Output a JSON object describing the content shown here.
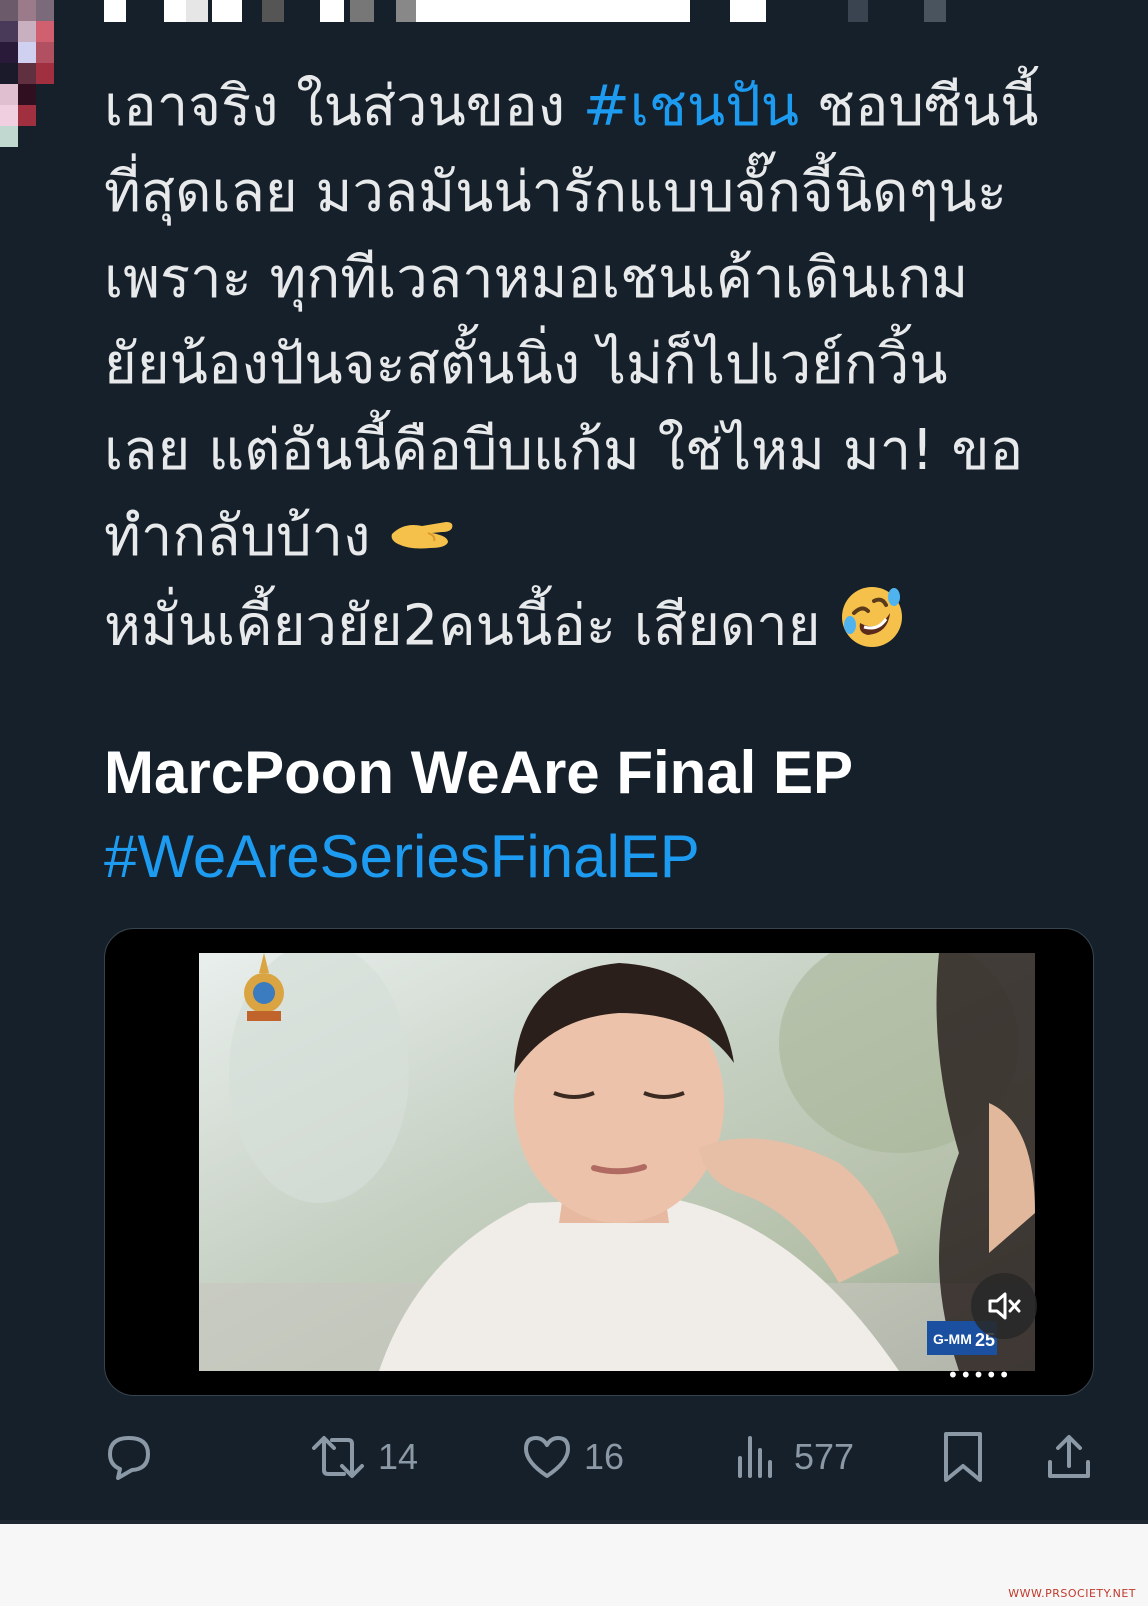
{
  "tweet": {
    "lines": [
      {
        "pre": "เอาจริง ในส่วนของ ",
        "hashtag": "#เชนปัน",
        "post": " ชอบซีนนี้"
      },
      {
        "pre": "ที่สุดเลย มวลมันน่ารักแบบจั๊กจี้นิดๆนะ",
        "hashtag": "",
        "post": ""
      },
      {
        "pre": "เพราะ ทุกทีเวลาหมอเชนเค้าเดินเกม",
        "hashtag": "",
        "post": ""
      },
      {
        "pre": "ยัยน้องปันจะสตั้นนิ่ง ไม่ก็ไปเวย์กวิ้น",
        "hashtag": "",
        "post": ""
      },
      {
        "pre": "เลย แต่อันนี้คือบีบแก้ม ใช่ไหม มา! ขอ",
        "hashtag": "",
        "post": ""
      },
      {
        "pre": "ทำกลับบ้าง ",
        "hashtag": "",
        "post": ""
      },
      {
        "pre": "หมั่นเคี้ยวยัย2คนนี้อ่ะ เสียดาย ",
        "hashtag": "",
        "post": ""
      }
    ],
    "title": "MarcPoon WeAre Final EP",
    "hashtag2": "#WeAreSeriesFinalEP"
  },
  "media": {
    "overlay_dots": "•••••"
  },
  "actions": {
    "retweets": "14",
    "likes": "16",
    "views": "577"
  },
  "icons": {
    "reply": "reply-icon",
    "retweet": "retweet-icon",
    "like": "heart-icon",
    "views": "views-icon",
    "bookmark": "bookmark-icon",
    "share": "share-icon",
    "mute": "mute-icon"
  },
  "colors": {
    "background": "#15202b",
    "text": "#e7e9ea",
    "accent": "#1d9bf0",
    "muted": "#8b98a5"
  },
  "watermark": "WWW.PRSOCIETY.NET"
}
